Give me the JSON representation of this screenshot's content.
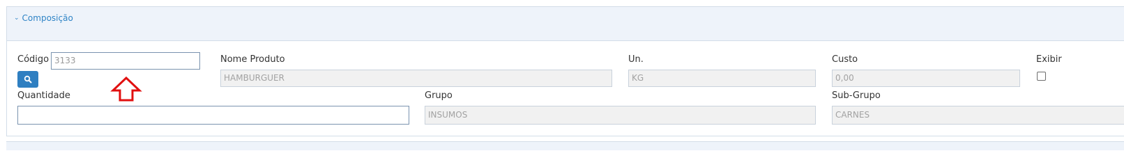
{
  "section": {
    "title": "Composição"
  },
  "form": {
    "codigo": {
      "label": "Código",
      "value": "3133"
    },
    "nome_produto": {
      "label": "Nome Produto",
      "value": "HAMBURGUER"
    },
    "unidade": {
      "label": "Un.",
      "value": "KG"
    },
    "custo": {
      "label": "Custo",
      "value": "0,00"
    },
    "exibir": {
      "label": "Exibir",
      "checked": false
    },
    "quantidade": {
      "label": "Quantidade",
      "value": ""
    },
    "grupo": {
      "label": "Grupo",
      "value": "INSUMOS"
    },
    "sub_grupo": {
      "label": "Sub-Grupo",
      "value": "CARNES"
    }
  },
  "icons": {
    "search": "search-icon",
    "collapse": "chevron-down-icon",
    "annotation": "up-arrow-icon"
  },
  "colors": {
    "accent": "#2f7fc1",
    "annotation": "#e11010"
  }
}
